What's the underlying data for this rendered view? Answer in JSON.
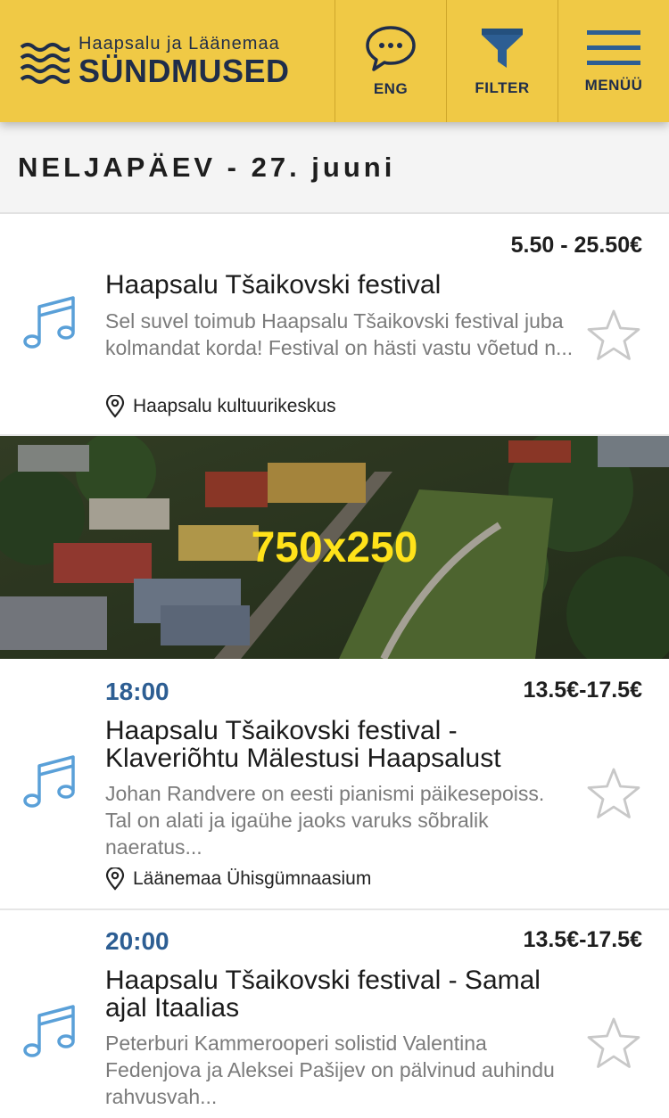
{
  "header": {
    "brand_subtitle": "Haapsalu ja Läänemaa",
    "brand_title": "SÜNDMUSED",
    "lang_label": "ENG",
    "filter_label": "FILTER",
    "menu_label": "MENÜÜ"
  },
  "date_heading": "NELJAPÄEV - 27. juuni",
  "colors": {
    "header_bg": "#f0c945",
    "brand_navy": "#1f2d4a",
    "accent_blue": "#2d5e93",
    "icon_blue": "#5aa0d8"
  },
  "events": [
    {
      "icon": "music-note-icon",
      "time": "",
      "price": "5.50 - 25.50€",
      "title": "Haapsalu Tšaikovski festival",
      "description": "Sel suvel toimub Haapsalu Tšaikovski festival juba kolmandat korda! Festival on hästi vastu võetud n...",
      "location": "Haapsalu kultuurikeskus"
    },
    {
      "icon": "music-note-icon",
      "time": "18:00",
      "price": "13.5€-17.5€",
      "title": "Haapsalu Tšaikovski festival - Klaveriõhtu Mälestusi Haapsalust",
      "description": "Johan Randvere on eesti pianismi päikesepoiss. Tal on alati ja igaühe jaoks varuks sõbralik naeratus...",
      "location": "Läänemaa Ühisgümnaasium"
    },
    {
      "icon": "music-note-icon",
      "time": "20:00",
      "price": "13.5€-17.5€",
      "title": "Haapsalu Tšaikovski festival - Samal ajal Itaalias",
      "description": "Peterburi Kammerooperi solistid Valentina Fedenjova ja Aleksei Pašijev on pälvinud auhindu rahvusvah...",
      "location": ""
    }
  ],
  "banner": {
    "label": "750x250"
  }
}
